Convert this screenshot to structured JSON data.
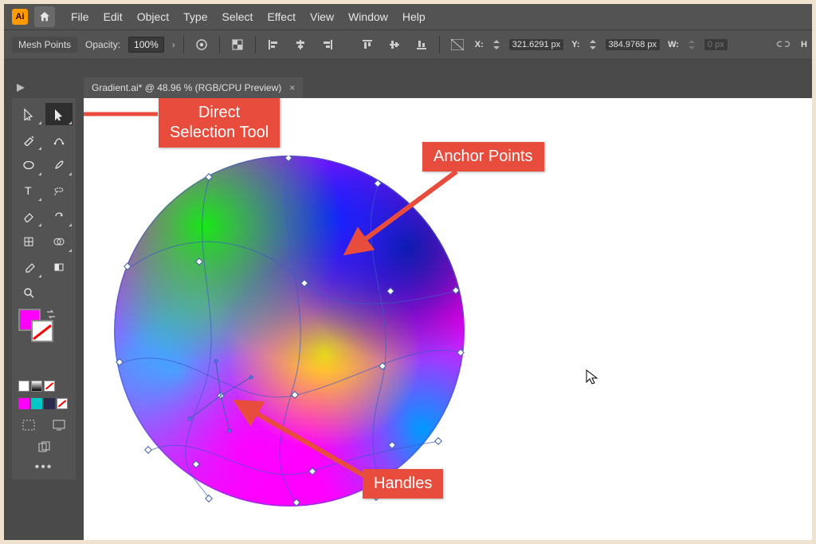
{
  "app": {
    "logo_text": "Ai"
  },
  "menu": {
    "items": [
      "File",
      "Edit",
      "Object",
      "Type",
      "Select",
      "Effect",
      "View",
      "Window",
      "Help"
    ]
  },
  "controlbar": {
    "mode_label": "Mesh Points",
    "opacity_label": "Opacity:",
    "opacity_value": "100%",
    "x_label": "X:",
    "x_value": "321.6291 px",
    "y_label": "Y:",
    "y_value": "384.9768 px",
    "w_label": "W:",
    "w_value": "0 px",
    "h_label": "H"
  },
  "tab": {
    "title": "Gradient.ai* @ 48.96 % (RGB/CPU Preview)",
    "close_glyph": "×"
  },
  "colors": {
    "fill": "#ff00ff",
    "swatches": [
      "#ff00ff",
      "#00c8c8",
      "#2b2b4d"
    ],
    "accent": "#e74c3c"
  },
  "annotations": {
    "direct_selection": "Direct\nSelection Tool",
    "anchor_points": "Anchor Points",
    "handles": "Handles"
  }
}
